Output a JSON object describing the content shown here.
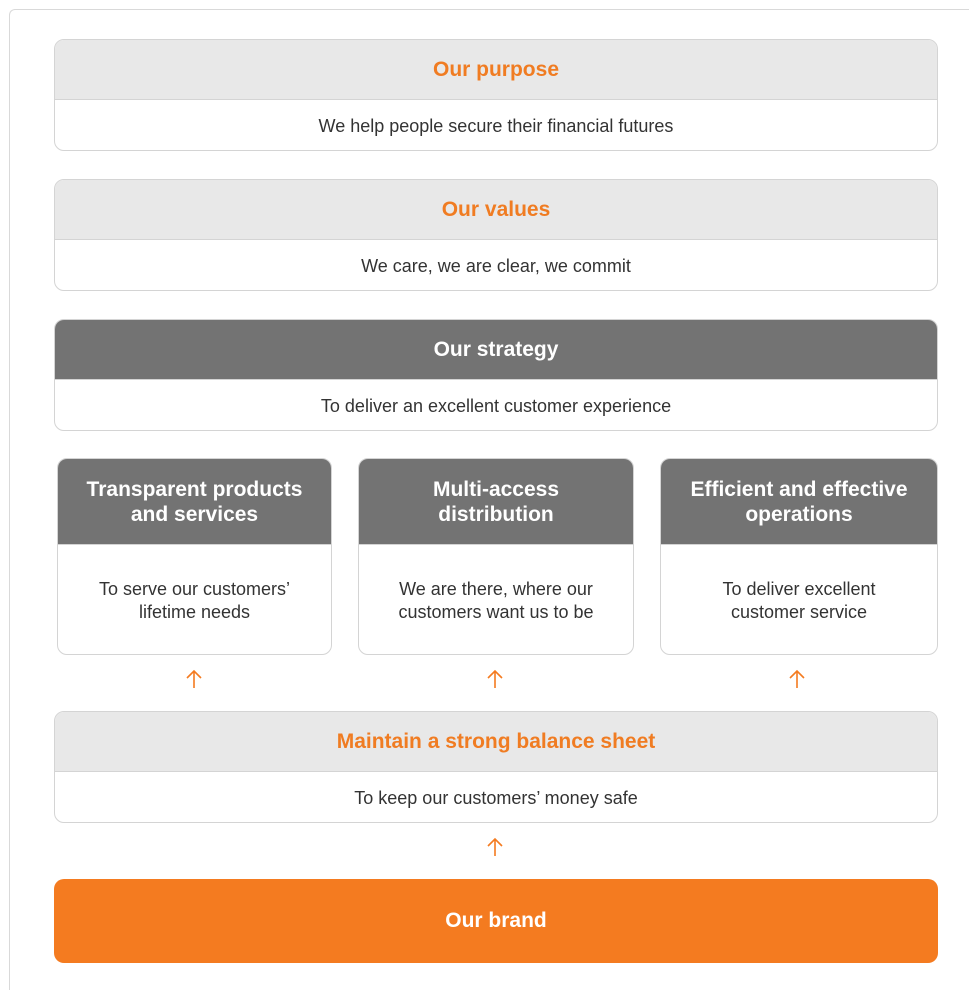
{
  "purpose": {
    "title": "Our purpose",
    "text": "We help people secure their financial futures"
  },
  "values": {
    "title": "Our values",
    "text": "We care, we are clear, we commit"
  },
  "strategy": {
    "title": "Our strategy",
    "text": "To deliver an excellent customer experience"
  },
  "pillars": [
    {
      "title": "Transparent products and services",
      "text": "To serve our customers’ lifetime needs"
    },
    {
      "title": "Multi-access distribution",
      "text": "We are there, where our customers want us to be"
    },
    {
      "title": "Efficient and effective operations",
      "text": "To deliver excellent customer service"
    }
  ],
  "balance": {
    "title": "Maintain a strong balance sheet",
    "text": "To keep our customers’ money safe"
  },
  "brand": {
    "label": "Our brand"
  },
  "icons": {
    "arrow": "arrow-up-icon"
  },
  "colors": {
    "accent": "#f47b20",
    "dark_header": "#737373",
    "light_header": "#e8e8e8"
  }
}
